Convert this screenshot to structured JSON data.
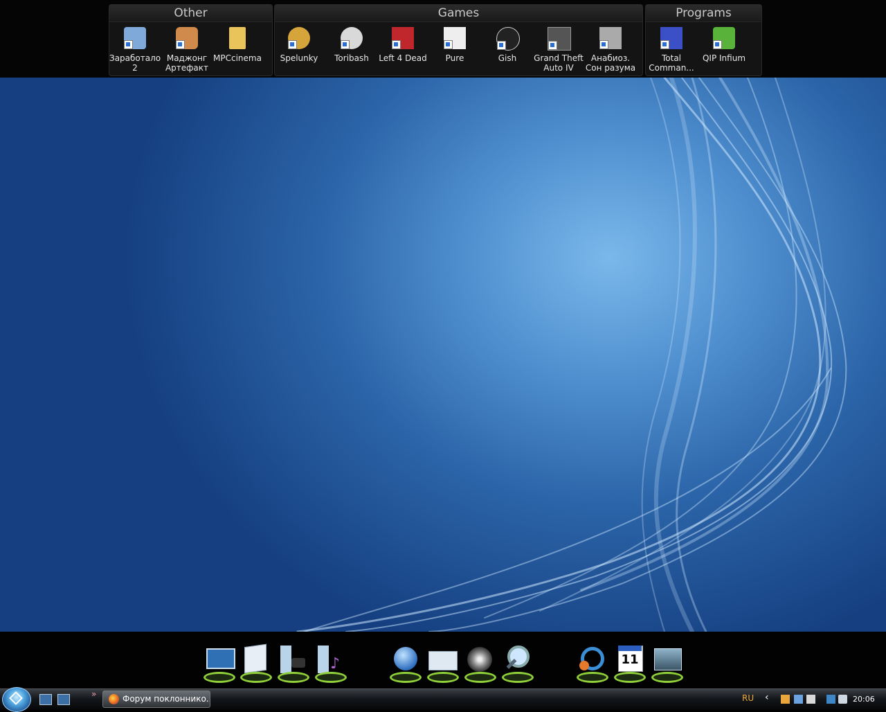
{
  "fences": [
    {
      "title": "Other",
      "icons": [
        {
          "label": "Заработало 2",
          "icon": "cartoon-face-icon",
          "color": "#7fa9d8"
        },
        {
          "label": "Маджонг Артефакт",
          "icon": "mahjong-tile-icon",
          "color": "#d08a4b"
        },
        {
          "label": "MPCcinema",
          "icon": "folder-icon",
          "color": "#e8c45a"
        }
      ]
    },
    {
      "title": "Games",
      "icons": [
        {
          "label": "Spelunky",
          "icon": "spelunky-icon",
          "color": "#d5a43a"
        },
        {
          "label": "Toribash",
          "icon": "toribash-icon",
          "color": "#d9d9d9"
        },
        {
          "label": "Left 4 Dead",
          "icon": "left4dead-icon",
          "color": "#c0272d"
        },
        {
          "label": "Pure",
          "icon": "pure-icon",
          "color": "#eeeeee"
        },
        {
          "label": "Gish",
          "icon": "gish-icon",
          "color": "#222222"
        },
        {
          "label": "Grand Theft Auto IV",
          "icon": "gta-icon",
          "color": "#555555"
        },
        {
          "label": "Анабиоз. Сон разума",
          "icon": "anabioz-icon",
          "color": "#aaaaaa"
        }
      ]
    },
    {
      "title": "Programs",
      "icons": [
        {
          "label": "Total Comman...",
          "icon": "floppy-icon",
          "color": "#3b4fc7"
        },
        {
          "label": "QIP Infium",
          "icon": "qip-icon",
          "color": "#59b33a"
        }
      ]
    }
  ],
  "dock": [
    {
      "icon": "desktop-icon"
    },
    {
      "icon": "documents-icon"
    },
    {
      "icon": "pictures-icon"
    },
    {
      "icon": "music-icon"
    },
    {
      "icon": "internet-icon"
    },
    {
      "icon": "mail-icon"
    },
    {
      "icon": "media-player-icon"
    },
    {
      "icon": "search-icon"
    },
    {
      "icon": "settings-icon"
    },
    {
      "icon": "calendar-icon",
      "text": "11"
    },
    {
      "icon": "computer-icon"
    }
  ],
  "taskbar": {
    "task_label": "Форум поклоннико...",
    "lang": "RU",
    "clock": "20:06"
  },
  "colors": {
    "accent": "#8fcf3a",
    "wallpaper": "#2b64a8"
  }
}
